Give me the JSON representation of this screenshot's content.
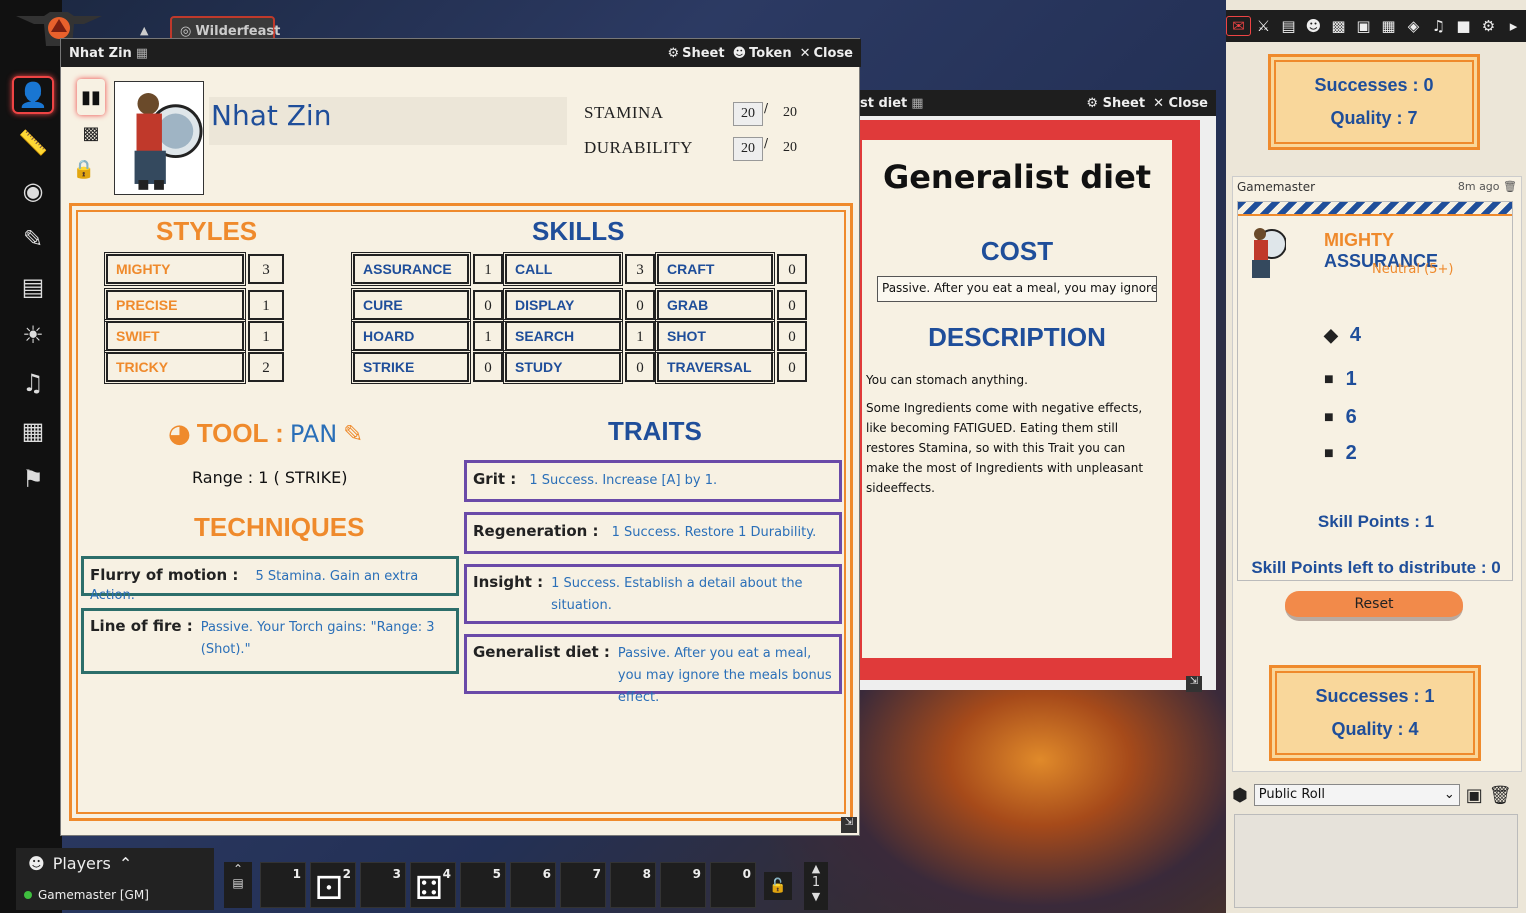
{
  "app": {
    "game_title": "Wilderfeast"
  },
  "left_toolbar": [
    "token-tool",
    "ruler-tool",
    "templates-tool",
    "drawing-tool",
    "walls-tool",
    "lighting-tool",
    "sound-tool",
    "tiles-tool",
    "notes-tool"
  ],
  "sheet": {
    "window_title": "Nhat Zin",
    "btn_sheet": "Sheet",
    "btn_token": "Token",
    "btn_close": "Close",
    "name": "Nhat Zin",
    "stamina_label": "STAMINA",
    "stamina_value": "20",
    "stamina_max": "20",
    "durability_label": "DURABILITY",
    "durability_value": "20",
    "durability_max": "20",
    "styles_header": "STYLES",
    "skills_header": "SKILLS",
    "styles": [
      {
        "name": "MIGHTY",
        "value": "3"
      },
      {
        "name": "PRECISE",
        "value": "1"
      },
      {
        "name": "SWIFT",
        "value": "1"
      },
      {
        "name": "TRICKY",
        "value": "2"
      }
    ],
    "skills": [
      {
        "name": "ASSURANCE",
        "value": "1"
      },
      {
        "name": "CALL",
        "value": "3"
      },
      {
        "name": "CRAFT",
        "value": "0"
      },
      {
        "name": "CURE",
        "value": "0"
      },
      {
        "name": "DISPLAY",
        "value": "0"
      },
      {
        "name": "GRAB",
        "value": "0"
      },
      {
        "name": "HOARD",
        "value": "1"
      },
      {
        "name": "SEARCH",
        "value": "1"
      },
      {
        "name": "SHOT",
        "value": "0"
      },
      {
        "name": "STRIKE",
        "value": "0"
      },
      {
        "name": "STUDY",
        "value": "0"
      },
      {
        "name": "TRAVERSAL",
        "value": "0"
      }
    ],
    "tool_label": "TOOL :",
    "tool_name": "PAN",
    "tool_range": "Range : 1 ( STRIKE)",
    "techniques_header": "TECHNIQUES",
    "techniques": [
      {
        "name": "Flurry of motion :",
        "desc": "5 Stamina. Gain an extra Action."
      },
      {
        "name": "Line of fire :",
        "desc": "Passive. Your Torch gains: \"Range: 3 (Shot).\""
      }
    ],
    "traits_header": "TRAITS",
    "traits": [
      {
        "name": "Grit :",
        "desc": "1 Success. Increase [A] by 1."
      },
      {
        "name": "Regeneration :",
        "desc": "1 Success. Restore 1 Durability."
      },
      {
        "name": "Insight :",
        "desc": "1 Success. Establish a detail about the situation."
      },
      {
        "name": "Generalist diet :",
        "desc": "Passive. After you eat a meal, you may ignore the meals bonus effect."
      }
    ]
  },
  "diet_sheet": {
    "window_title": "st diet",
    "btn_sheet": "Sheet",
    "btn_close": "Close",
    "title": "Generalist diet",
    "cost_header": "COST",
    "cost_value": "Passive. After you eat a meal, you may ignore",
    "description_header": "DESCRIPTION",
    "desc_p1": "You can stomach anything.",
    "desc_p2": "Some Ingredients come with negative effects, like becoming FATIGUED. Eating them still restores Stamina, so with this Trait you can make the most of Ingredients with unpleasant sideeffects."
  },
  "chat": {
    "top_result": {
      "successes": "Successes : 0",
      "quality": "Quality : 7"
    },
    "message_author": "Gamemaster",
    "message_time": "8m ago",
    "roll_title_style": "MIGHTY",
    "roll_title_skill": "ASSURANCE",
    "roll_difficulty": "Neutral (5+)",
    "dice": [
      "4",
      "1",
      "6",
      "2"
    ],
    "skill_points": "Skill Points : 1",
    "skill_points_left": "Skill Points left to distribute : 0",
    "reset_label": "Reset",
    "bottom_result": {
      "successes": "Successes : 1",
      "quality": "Quality : 4"
    },
    "roll_mode": "Public Roll"
  },
  "players": {
    "header": "Players",
    "entry": "Gamemaster [GM]",
    "online_color": "#3fbf3f"
  },
  "hotbar": {
    "slots": [
      "1",
      "2",
      "3",
      "4",
      "5",
      "6",
      "7",
      "8",
      "9",
      "0"
    ],
    "page": "1"
  },
  "colors": {
    "accent_orange": "#ef8a2c",
    "accent_blue": "#1f4e9a",
    "technique_border": "#2c6e6a",
    "trait_border": "#6a4aa8",
    "card_red": "#e03a3a"
  }
}
